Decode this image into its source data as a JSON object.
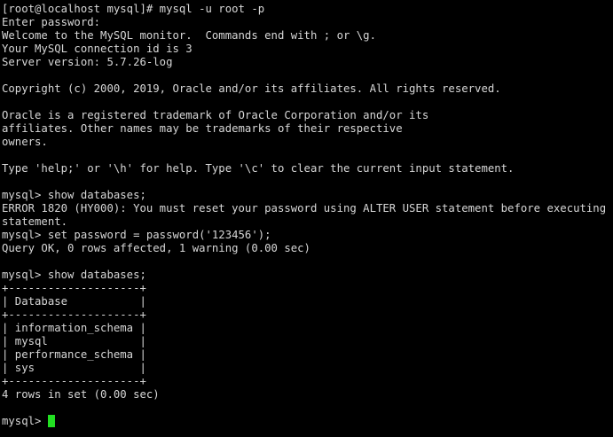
{
  "terminal": {
    "colors": {
      "background": "#000000",
      "foreground": "#d7d7d7",
      "cursor": "#22e022"
    },
    "lines": [
      "[root@localhost mysql]# mysql -u root -p",
      "Enter password:",
      "Welcome to the MySQL monitor.  Commands end with ; or \\g.",
      "Your MySQL connection id is 3",
      "Server version: 5.7.26-log",
      "",
      "Copyright (c) 2000, 2019, Oracle and/or its affiliates. All rights reserved.",
      "",
      "Oracle is a registered trademark of Oracle Corporation and/or its",
      "affiliates. Other names may be trademarks of their respective",
      "owners.",
      "",
      "Type 'help;' or '\\h' for help. Type '\\c' to clear the current input statement.",
      "",
      "mysql> show databases;",
      "ERROR 1820 (HY000): You must reset your password using ALTER USER statement before executing this",
      "statement.",
      "mysql> set password = password('123456');",
      "Query OK, 0 rows affected, 1 warning (0.00 sec)",
      "",
      "mysql> show databases;",
      "+--------------------+",
      "| Database           |",
      "+--------------------+",
      "| information_schema |",
      "| mysql              |",
      "| performance_schema |",
      "| sys                |",
      "+--------------------+",
      "4 rows in set (0.00 sec)",
      ""
    ],
    "prompt": "mysql> "
  }
}
